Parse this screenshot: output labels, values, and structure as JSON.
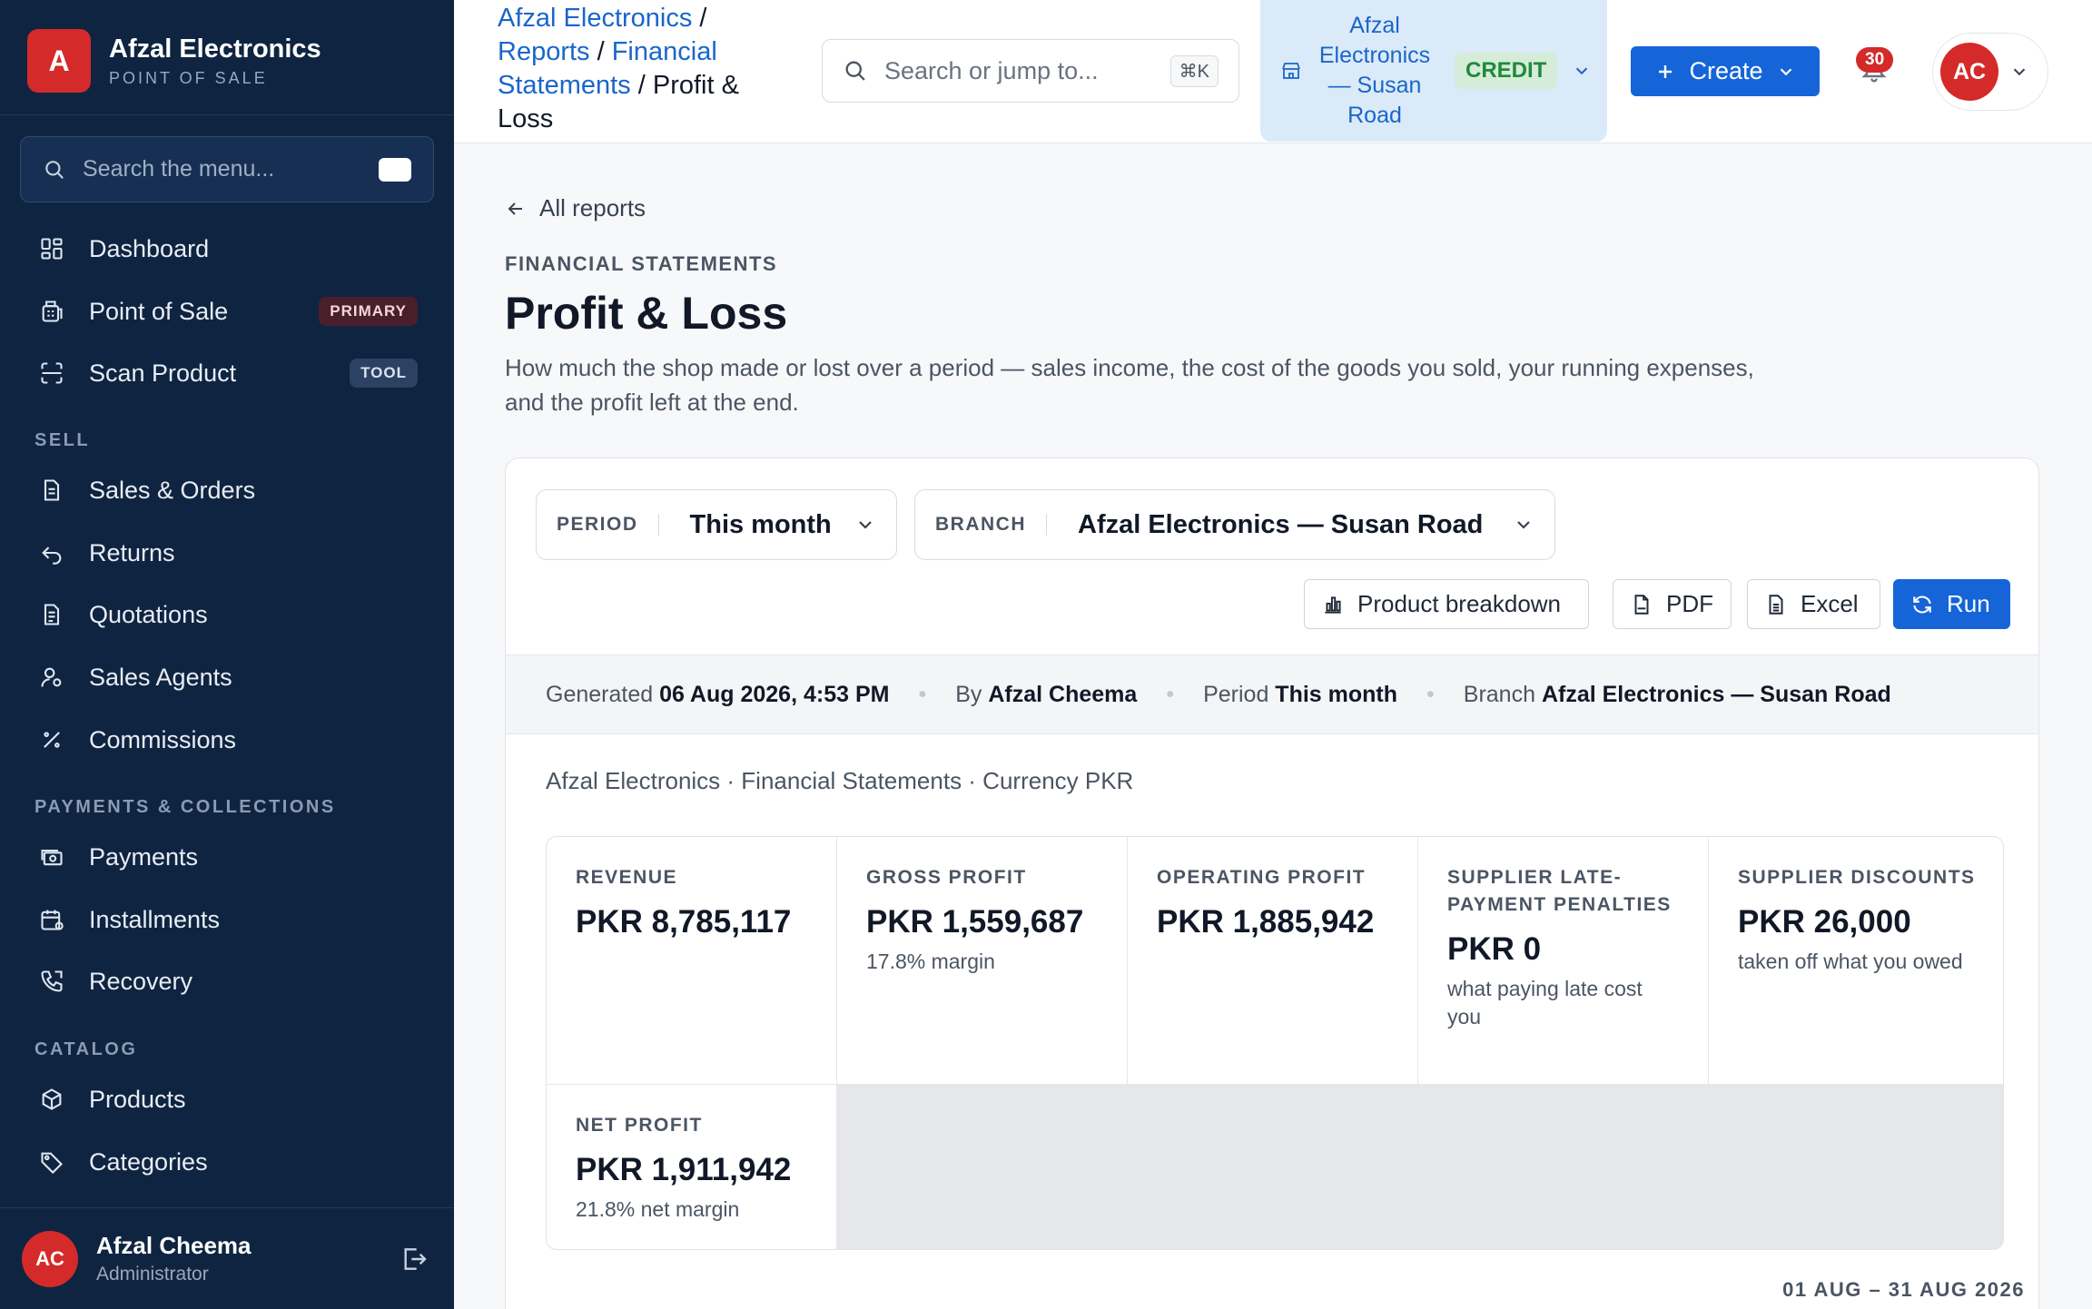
{
  "brand": {
    "logo_letter": "A",
    "name": "Afzal Electronics",
    "subtitle": "POINT OF SALE"
  },
  "sidebar": {
    "search_placeholder": "Search the menu...",
    "items": [
      {
        "label": "Dashboard",
        "icon": "dashboard-icon"
      },
      {
        "label": "Point of Sale",
        "icon": "pos-icon",
        "badge": "PRIMARY"
      },
      {
        "label": "Scan Product",
        "icon": "scan-icon",
        "badge": "TOOL"
      },
      {
        "label": "Sales & Orders",
        "icon": "document-icon"
      },
      {
        "label": "Returns",
        "icon": "return-icon"
      },
      {
        "label": "Quotations",
        "icon": "quote-icon"
      },
      {
        "label": "Sales Agents",
        "icon": "agent-icon"
      },
      {
        "label": "Commissions",
        "icon": "percent-icon"
      },
      {
        "label": "Payments",
        "icon": "cash-icon"
      },
      {
        "label": "Installments",
        "icon": "calendar-icon"
      },
      {
        "label": "Recovery",
        "icon": "phone-icon"
      },
      {
        "label": "Products",
        "icon": "box-icon"
      },
      {
        "label": "Categories",
        "icon": "tag-icon"
      }
    ],
    "sections": [
      "SELL",
      "PAYMENTS & COLLECTIONS",
      "CATALOG"
    ],
    "user": {
      "initials": "AC",
      "name": "Afzal Cheema",
      "role": "Administrator"
    }
  },
  "topbar": {
    "breadcrumb": [
      "Afzal Electronics",
      "Reports",
      "Financial Statements",
      "Profit & Loss"
    ],
    "search_placeholder": "Search or jump to...",
    "search_shortcut": "⌘K",
    "branch": "Afzal Electronics — Susan Road",
    "branch_mode": "CREDIT",
    "create_label": "Create",
    "notifications": "30",
    "avatar_initials": "AC"
  },
  "page": {
    "back_label": "All reports",
    "kicker": "FINANCIAL STATEMENTS",
    "title": "Profit & Loss",
    "description": "How much the shop made or lost over a period — sales income, the cost of the goods you sold, your running expenses, and the profit left at the end."
  },
  "filters": {
    "period_label": "PERIOD",
    "period_value": "This month",
    "branch_label": "BRANCH",
    "branch_value": "Afzal Electronics — Susan Road"
  },
  "actions": {
    "breakdown": "Product breakdown",
    "pdf": "PDF",
    "excel": "Excel",
    "run": "Run"
  },
  "meta": {
    "generated_label": "Generated",
    "generated_value": "06 Aug 2026, 4:53 PM",
    "by_label": "By",
    "by_value": "Afzal Cheema",
    "period_label": "Period",
    "period_value": "This month",
    "branch_label": "Branch",
    "branch_value": "Afzal Electronics — Susan Road"
  },
  "context_line": "Afzal Electronics · Financial Statements · Currency PKR",
  "kpis": [
    {
      "label": "Revenue",
      "value": "PKR 8,785,117",
      "sub": ""
    },
    {
      "label": "Gross profit",
      "value": "PKR 1,559,687",
      "sub": "17.8% margin"
    },
    {
      "label": "Operating profit",
      "value": "PKR 1,885,942",
      "sub": ""
    },
    {
      "label": "Supplier late-payment penalties",
      "value": "PKR 0",
      "sub": "what paying late cost you"
    },
    {
      "label": "Supplier discounts",
      "value": "PKR 26,000",
      "sub": "taken off what you owed"
    },
    {
      "label": "Net profit",
      "value": "PKR 1,911,942",
      "sub": "21.8% net margin"
    }
  ],
  "date_range": "01 AUG – 31 AUG 2026",
  "colors": {
    "sidebar_bg": "#0f2441",
    "accent": "#1565d8",
    "brand_red": "#d42a2a",
    "credit_green": "#1f8a3b"
  }
}
